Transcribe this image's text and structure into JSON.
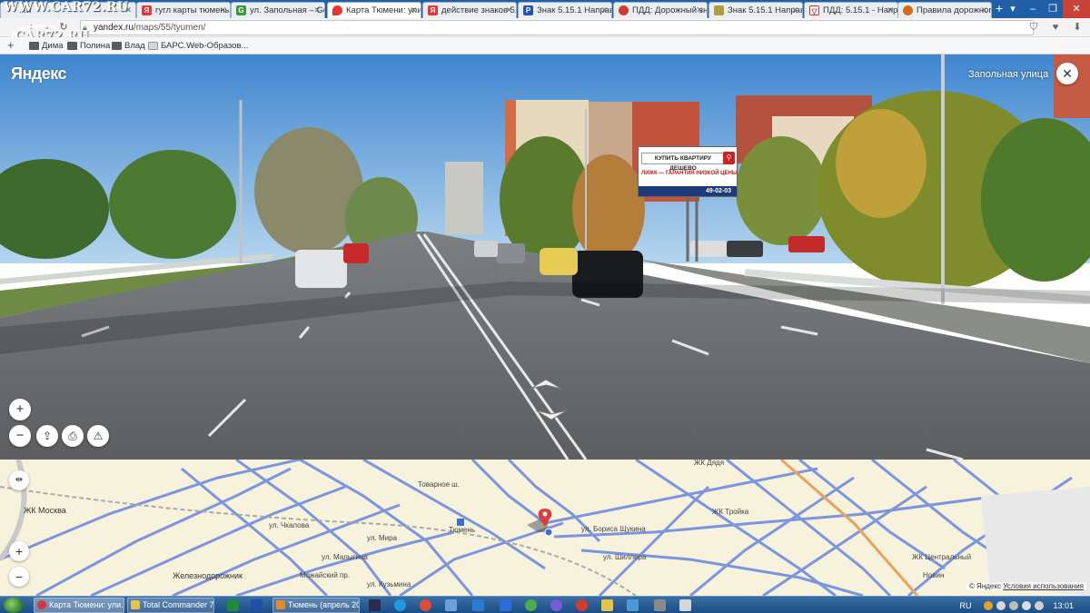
{
  "watermark": "WWW.CAR72.RU",
  "logo_text": "CAR72.RU",
  "tabs": [
    {
      "label": "...и"
    },
    {
      "label": "гугл карты тюмень -"
    },
    {
      "label": "ул. Запольная – Goo"
    },
    {
      "label": "Карта Тюмени: улиц"
    },
    {
      "label": "действие знаков 5.1"
    },
    {
      "label": "Знак 5.15.1 Направл"
    },
    {
      "label": "ПДД: Дорожный зна"
    },
    {
      "label": "Знак 5.15.1 Направ"
    },
    {
      "label": "ПДД: 5.15.1 - Направ"
    },
    {
      "label": "Правила дорожного"
    }
  ],
  "address": {
    "host": "yandex.ru",
    "path": "/maps/55/tyumen/"
  },
  "bookmarks": [
    {
      "label": "Дима"
    },
    {
      "label": "Полина"
    },
    {
      "label": "Влад"
    },
    {
      "label": "БАРС.Web-Образов..."
    }
  ],
  "panorama": {
    "logo": "Яндекс",
    "street_label": "Запольная улица",
    "billboard": {
      "line1": "КУПИТЬ КВАРТИРУ ДЕШЕВО",
      "line2": "ЛИЖК — ГАРАНТИЯ НИЗКОЙ ЦЕНЫ",
      "phone": "49-02-03"
    }
  },
  "map": {
    "labels": [
      {
        "text": "ЖК Москва"
      },
      {
        "text": "Железнодорожник"
      },
      {
        "text": "Тюмень"
      },
      {
        "text": "ул. Мира"
      },
      {
        "text": "ул. Малыгина"
      },
      {
        "text": "ул. Чкалова"
      },
      {
        "text": "Товарное ш."
      },
      {
        "text": "ЖК Дядя"
      },
      {
        "text": "ул. Бориса Щукина"
      },
      {
        "text": "ЖК Тройка"
      },
      {
        "text": "ЖК Центральный"
      },
      {
        "text": "Новин"
      },
      {
        "text": "ул. Шиллера"
      },
      {
        "text": "Можайский пр."
      },
      {
        "text": "ул. Кузьмина"
      }
    ],
    "copyright": "© Яндекс",
    "terms": "Условия использования"
  },
  "taskbar": {
    "tasks": [
      {
        "label": "Карта Тюмени: ули..."
      },
      {
        "label": "Total Commander 7...."
      },
      {
        "label": "Тюмень (апрель 20..."
      }
    ],
    "lang": "RU",
    "time": "13:01"
  },
  "colors": {
    "tabbar": "#1f5fa6",
    "map_bg": "#f7f2dc",
    "road": "#5b7fdb",
    "marker": "#e03b3b",
    "yandex_red": "#e33333"
  }
}
